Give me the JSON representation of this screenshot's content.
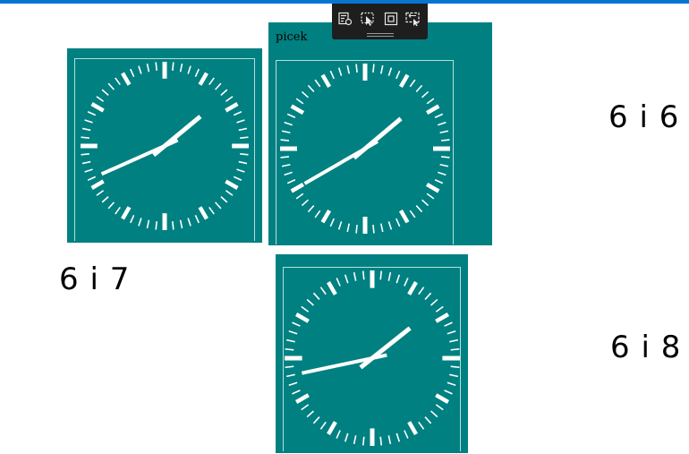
{
  "window": {
    "accent_color": "#0a74d1"
  },
  "toolbar": {
    "buttons": [
      {
        "icon": "live-visual-tree-icon"
      },
      {
        "icon": "select-element-icon"
      },
      {
        "icon": "display-layout-adorners-icon"
      },
      {
        "icon": "track-focus-icon"
      }
    ]
  },
  "clocks": [
    {
      "name": "clock-6-7",
      "hour": 1,
      "minute": 41,
      "caption": ""
    },
    {
      "name": "clock-6-6",
      "hour": 1,
      "minute": 40,
      "caption": "picek"
    },
    {
      "name": "clock-6-8",
      "hour": 1,
      "minute": 43,
      "caption": ""
    }
  ],
  "colors": {
    "clock_face": "#008080",
    "clock_marks": "#ffffff",
    "frame": "#b7dede"
  },
  "labels": {
    "label_6_6": "6 i 6",
    "label_6_7": "6 i 7",
    "label_6_8": "6 i 8"
  }
}
